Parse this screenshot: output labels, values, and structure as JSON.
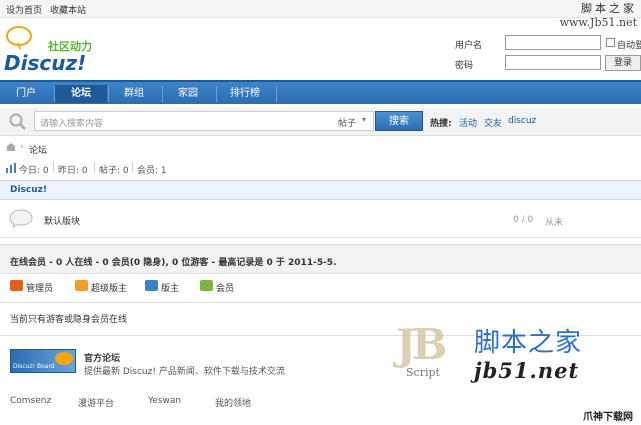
{
  "topbar": {
    "set_home": "设为首页",
    "bookmark": "收藏本站"
  },
  "watermark_top": {
    "cn": "脚本之家",
    "url": "www.Jb51.net"
  },
  "logo": {
    "tagline": "社区动力",
    "wordmark": "Discuz!"
  },
  "login": {
    "username_label": "用户名",
    "password_label": "密码",
    "auto_login_label": "自动登录",
    "login_button": "登录"
  },
  "nav": {
    "items": [
      "门户",
      "论坛",
      "群组",
      "家园",
      "排行榜"
    ],
    "active_index": 1
  },
  "search": {
    "placeholder": "请输入搜索内容",
    "type_label": "帖子",
    "button": "搜索",
    "hot_label": "热搜:",
    "hot_tags": [
      "活动",
      "交友",
      "discuz"
    ]
  },
  "breadcrumb": {
    "separator": "›",
    "current": "论坛"
  },
  "stats": {
    "today": "今日: 0",
    "yesterday": "昨日: 0",
    "posts": "帖子: 0",
    "members": "会员: 1"
  },
  "category": {
    "name": "Discuz!",
    "forums": [
      {
        "name": "默认版块",
        "counts": "0 / 0",
        "last_post": "从未"
      }
    ]
  },
  "online": {
    "header": "在线会员 - 0 人在线 - 0 会员(0 隐身), 0 位游客 - 最高记录是 0 于 2011-5-5.",
    "legend": [
      "管理员",
      "超级版主",
      "版主",
      "会员"
    ],
    "legend_colors": [
      "#e65c1a",
      "#f0a028",
      "#3b82c8",
      "#7cb342"
    ],
    "message": "当前只有游客或隐身会员在线"
  },
  "links": {
    "official_title": "官方论坛",
    "official_desc": "提供最新 Discuz! 产品新闻、软件下载与技术交流",
    "logo_text": "Discuz! Board",
    "partners": [
      "Comsenz",
      "漫游平台",
      "Yeswan",
      "我的领地"
    ]
  },
  "watermark_bottom": {
    "jb": "JB",
    "script": "Script",
    "cn": "脚本之家",
    "url": "jb51.net",
    "site": "爪神下载网"
  }
}
